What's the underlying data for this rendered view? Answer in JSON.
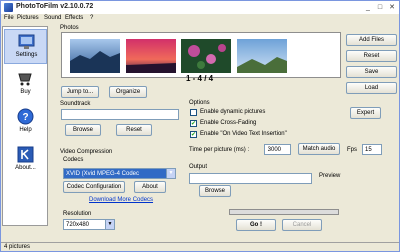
{
  "window": {
    "title": "PhotoToFilm v2.10.0.72",
    "minimize": "_",
    "maximize": "□",
    "close": "✕"
  },
  "menu": [
    "File",
    "Pictures",
    "Sound",
    "Effects",
    "?"
  ],
  "sidebar": [
    {
      "label": "Settings",
      "icon": "settings-icon"
    },
    {
      "label": "Buy",
      "icon": "buy-icon"
    },
    {
      "label": "Help",
      "icon": "help-icon"
    },
    {
      "label": "About...",
      "icon": "about-icon"
    }
  ],
  "photos": {
    "label": "Photos",
    "counter": "1 - 4 / 4",
    "jump_button": "Jump to...",
    "organize_button": "Organize"
  },
  "right_buttons": {
    "add_files": "Add Files",
    "reset": "Reset",
    "save": "Save",
    "load": "Load"
  },
  "soundtrack": {
    "label": "Soundtrack",
    "value": "",
    "browse": "Browse",
    "reset": "Reset"
  },
  "options": {
    "label": "Options",
    "expert": "Expert",
    "checks": [
      {
        "label": "Enable dynamic pictures",
        "checked": false
      },
      {
        "label": "Enable Cross-Fading",
        "checked": true
      },
      {
        "label": "Enable \"On Video Text Insertion\"",
        "checked": true
      }
    ],
    "time_label": "Time per picture (ms) :",
    "time_value": "3000",
    "match_audio": "Match audio",
    "fps_label": "Fps",
    "fps_value": "15"
  },
  "video": {
    "label": "Video Compression",
    "codecs_label": "Codecs",
    "codec_value": "XVID (Xvid MPEG-4 Codec",
    "codec_config": "Codec Configuration",
    "about": "About",
    "download_link": "Download More Codecs",
    "resolution_label": "Resolution",
    "resolution_value": "720x480"
  },
  "output": {
    "label": "Output",
    "value": "",
    "browse": "Browse",
    "preview_label": "Preview"
  },
  "actions": {
    "go": "Go !",
    "cancel": "Cancel"
  },
  "status": {
    "text": "4 pictures"
  }
}
